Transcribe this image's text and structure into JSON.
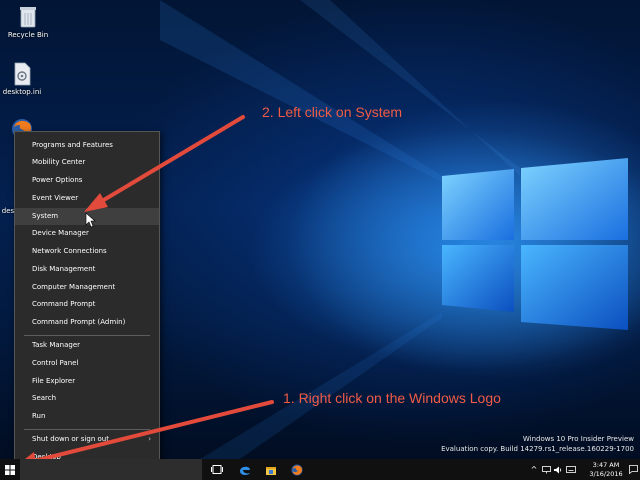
{
  "desktop": {
    "icons": [
      {
        "label": "Recycle Bin"
      },
      {
        "label": "desktop.ini"
      },
      {
        "label": "desktop.ini"
      }
    ]
  },
  "context_menu": {
    "items": [
      {
        "label": "Programs and Features"
      },
      {
        "label": "Mobility Center"
      },
      {
        "label": "Power Options"
      },
      {
        "label": "Event Viewer"
      },
      {
        "label": "System"
      },
      {
        "label": "Device Manager"
      },
      {
        "label": "Network Connections"
      },
      {
        "label": "Disk Management"
      },
      {
        "label": "Computer Management"
      },
      {
        "label": "Command Prompt"
      },
      {
        "label": "Command Prompt (Admin)"
      },
      {
        "label": "Task Manager"
      },
      {
        "label": "Control Panel"
      },
      {
        "label": "File Explorer"
      },
      {
        "label": "Search"
      },
      {
        "label": "Run"
      },
      {
        "label": "Shut down or sign out"
      },
      {
        "label": "Desktop"
      }
    ],
    "highlighted": "System"
  },
  "annotations": {
    "step2": "2. Left click on System",
    "step1": "1. Right click on the Windows Logo",
    "color": "#f15b45"
  },
  "watermark": {
    "line1": "Windows 10 Pro Insider Preview",
    "line2": "Evaluation copy. Build 14279.rs1_release.160229-1700"
  },
  "taskbar": {
    "icons": [
      "windows-logo-icon",
      "task-view-icon",
      "edge-icon",
      "store-icon",
      "file-explorer-icon",
      "firefox-icon"
    ],
    "tray": {
      "time": "3:47 AM",
      "date": "3/16/2016"
    }
  },
  "colors": {
    "menu_bg": "#2b2b2b",
    "menu_highlight": "#3f3f3f",
    "taskbar_bg": "#101010",
    "accent_blue": "#1e90ff"
  }
}
